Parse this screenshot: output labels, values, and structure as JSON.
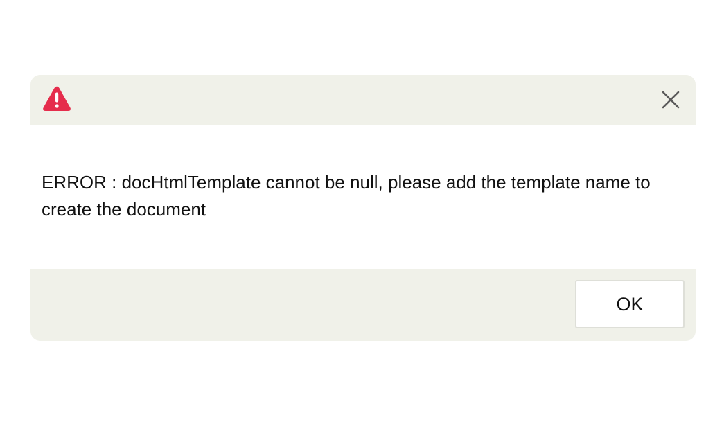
{
  "dialog": {
    "message": "ERROR : docHtmlTemplate cannot be null, please add the template name to create the document",
    "ok_label": "OK",
    "icons": {
      "status": "warning-triangle-icon",
      "close": "close-icon"
    },
    "colors": {
      "warning": "#e52d4c",
      "panel_background": "#f0f1e9",
      "close_icon": "#5a5a5a"
    }
  }
}
